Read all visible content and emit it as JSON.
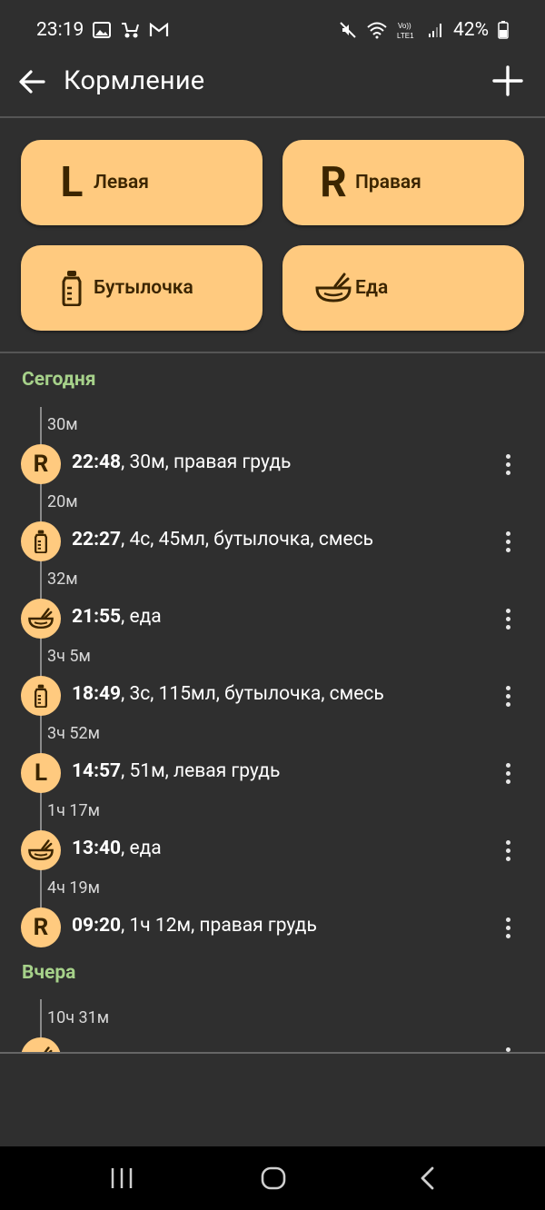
{
  "status_bar": {
    "time": "23:19",
    "battery": "42%",
    "network": "VoLTE LTE1"
  },
  "app_bar": {
    "title": "Кормление"
  },
  "quick_actions": [
    {
      "id": "left",
      "letter": "L",
      "label": "Левая"
    },
    {
      "id": "right",
      "letter": "R",
      "label": "Правая"
    },
    {
      "id": "bottle",
      "icon": "bottle-icon",
      "label": "Бутылочка"
    },
    {
      "id": "food",
      "icon": "bowl-icon",
      "label": "Еда"
    }
  ],
  "sections": {
    "today": "Сегодня",
    "yesterday": "Вчера"
  },
  "entries": [
    {
      "gap": "30м",
      "type": "R",
      "time": "22:48",
      "details": ", 30м, правая грудь"
    },
    {
      "gap": "20м",
      "type": "bottle",
      "time": "22:27",
      "details": ", 4с, 45мл, бутылочка, смесь"
    },
    {
      "gap": "32м",
      "type": "food",
      "time": "21:55",
      "details": ", еда"
    },
    {
      "gap": "3ч 5м",
      "type": "bottle",
      "time": "18:49",
      "details": ", 3с, 115мл, бутылочка, смесь"
    },
    {
      "gap": "3ч 52м",
      "type": "L",
      "time": "14:57",
      "details": ", 51м, левая грудь"
    },
    {
      "gap": "1ч 17м",
      "type": "food",
      "time": "13:40",
      "details": ", еда"
    },
    {
      "gap": "4ч 19м",
      "type": "R",
      "time": "09:20",
      "details": ", 1ч 12м, правая грудь"
    }
  ],
  "yesterday_entries": [
    {
      "gap": "10ч 31м",
      "type": "food",
      "time": "",
      "details": ""
    }
  ],
  "colors": {
    "accent": "#ffca7f",
    "section": "#a6d18a",
    "background": "#2f2f2f"
  }
}
